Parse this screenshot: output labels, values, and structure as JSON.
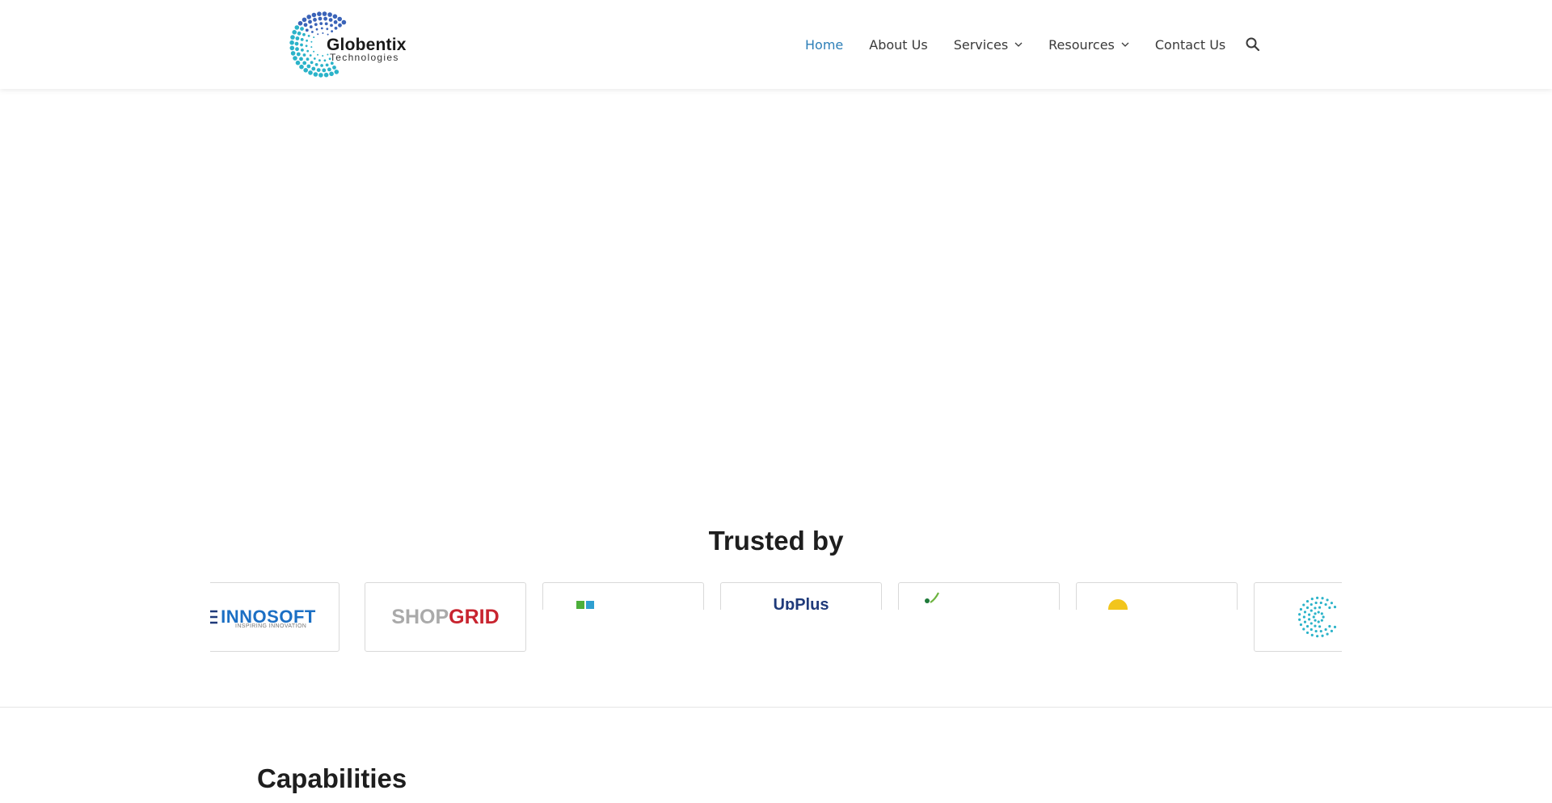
{
  "brand": {
    "name": "Globentix",
    "tagline": "Technologies",
    "colors": {
      "primary_dots": "#2bb3c9",
      "secondary_dots": "#3a63b8"
    }
  },
  "nav": {
    "items": [
      {
        "label": "Home",
        "active": true,
        "dropdown": false
      },
      {
        "label": "About Us",
        "active": false,
        "dropdown": false
      },
      {
        "label": "Services",
        "active": false,
        "dropdown": true
      },
      {
        "label": "Resources",
        "active": false,
        "dropdown": true
      },
      {
        "label": "Contact Us",
        "active": false,
        "dropdown": false
      }
    ],
    "search_icon": "search-icon",
    "active_color": "#2d7fb8"
  },
  "trusted": {
    "title": "Trusted by",
    "logos": [
      {
        "name": "INNOSOFT",
        "sub": "INSPIRING INNOVATION"
      },
      {
        "name_a": "SHOP",
        "name_b": "GRID"
      },
      {
        "name": ""
      },
      {
        "name": "UpPlus"
      },
      {
        "name": ""
      },
      {
        "name": ""
      },
      {
        "name": ""
      }
    ]
  },
  "capabilities": {
    "title": "Capabilities"
  }
}
